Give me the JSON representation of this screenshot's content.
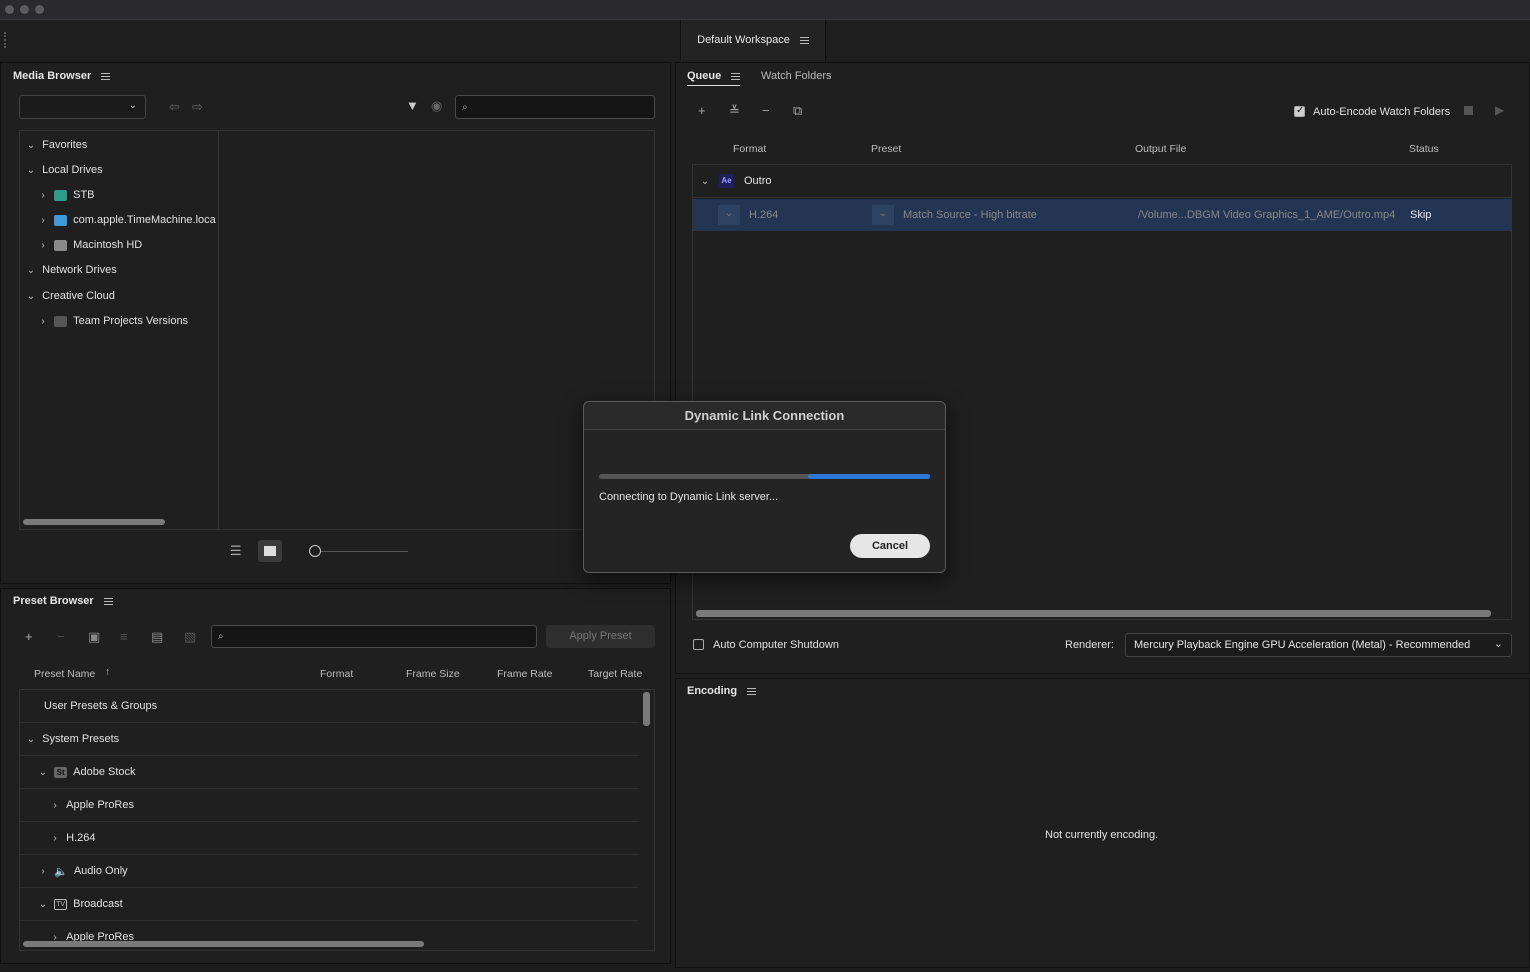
{
  "workspace": {
    "title": "Default Workspace"
  },
  "media_browser": {
    "title": "Media Browser",
    "tree": [
      {
        "label": "Favorites",
        "expanded": true,
        "level": 0
      },
      {
        "label": "Local Drives",
        "expanded": true,
        "level": 0
      },
      {
        "label": "STB",
        "level": 1,
        "icon": "drive-icon"
      },
      {
        "label": "com.apple.TimeMachine.loca",
        "level": 1,
        "icon": "folder-icon"
      },
      {
        "label": "Macintosh HD",
        "level": 1,
        "icon": "harddisk-icon"
      },
      {
        "label": "Network Drives",
        "expanded": true,
        "level": 0
      },
      {
        "label": "Creative Cloud",
        "expanded": true,
        "level": 0
      },
      {
        "label": "Team Projects Versions",
        "level": 1,
        "icon": "team-projects-icon"
      }
    ]
  },
  "queue": {
    "tabs": {
      "queue": "Queue",
      "watch": "Watch Folders"
    },
    "auto_encode_label": "Auto-Encode Watch Folders",
    "columns": {
      "format": "Format",
      "preset": "Preset",
      "output": "Output File",
      "status": "Status"
    },
    "group": {
      "badge": "Ae",
      "name": "Outro"
    },
    "item": {
      "format": "H.264",
      "preset": "Match Source - High bitrate",
      "output": "/Volume...DBGM Video Graphics_1_AME/Outro.mp4",
      "status": "Skip"
    },
    "auto_shutdown_label": "Auto Computer Shutdown",
    "renderer_label": "Renderer:",
    "renderer_value": "Mercury Playback Engine GPU Acceleration (Metal) - Recommended"
  },
  "preset_browser": {
    "title": "Preset Browser",
    "apply_label": "Apply Preset",
    "columns": {
      "name": "Preset Name",
      "format": "Format",
      "frame_size": "Frame Size",
      "frame_rate": "Frame Rate",
      "target_rate": "Target Rate"
    },
    "rows": [
      {
        "label": "User Presets & Groups"
      },
      {
        "label": "System Presets"
      },
      {
        "label": "Adobe Stock",
        "badge": "St"
      },
      {
        "label": "Apple ProRes"
      },
      {
        "label": "H.264"
      },
      {
        "label": "Audio Only"
      },
      {
        "label": "Broadcast",
        "badge": "TV"
      },
      {
        "label": "Apple ProRes"
      }
    ]
  },
  "encoding": {
    "title": "Encoding",
    "status": "Not currently encoding."
  },
  "dialog": {
    "title": "Dynamic Link Connection",
    "message": "Connecting to Dynamic Link server...",
    "cancel_label": "Cancel",
    "progress_segment_start": 0.63,
    "progress_segment_end": 1.0
  }
}
